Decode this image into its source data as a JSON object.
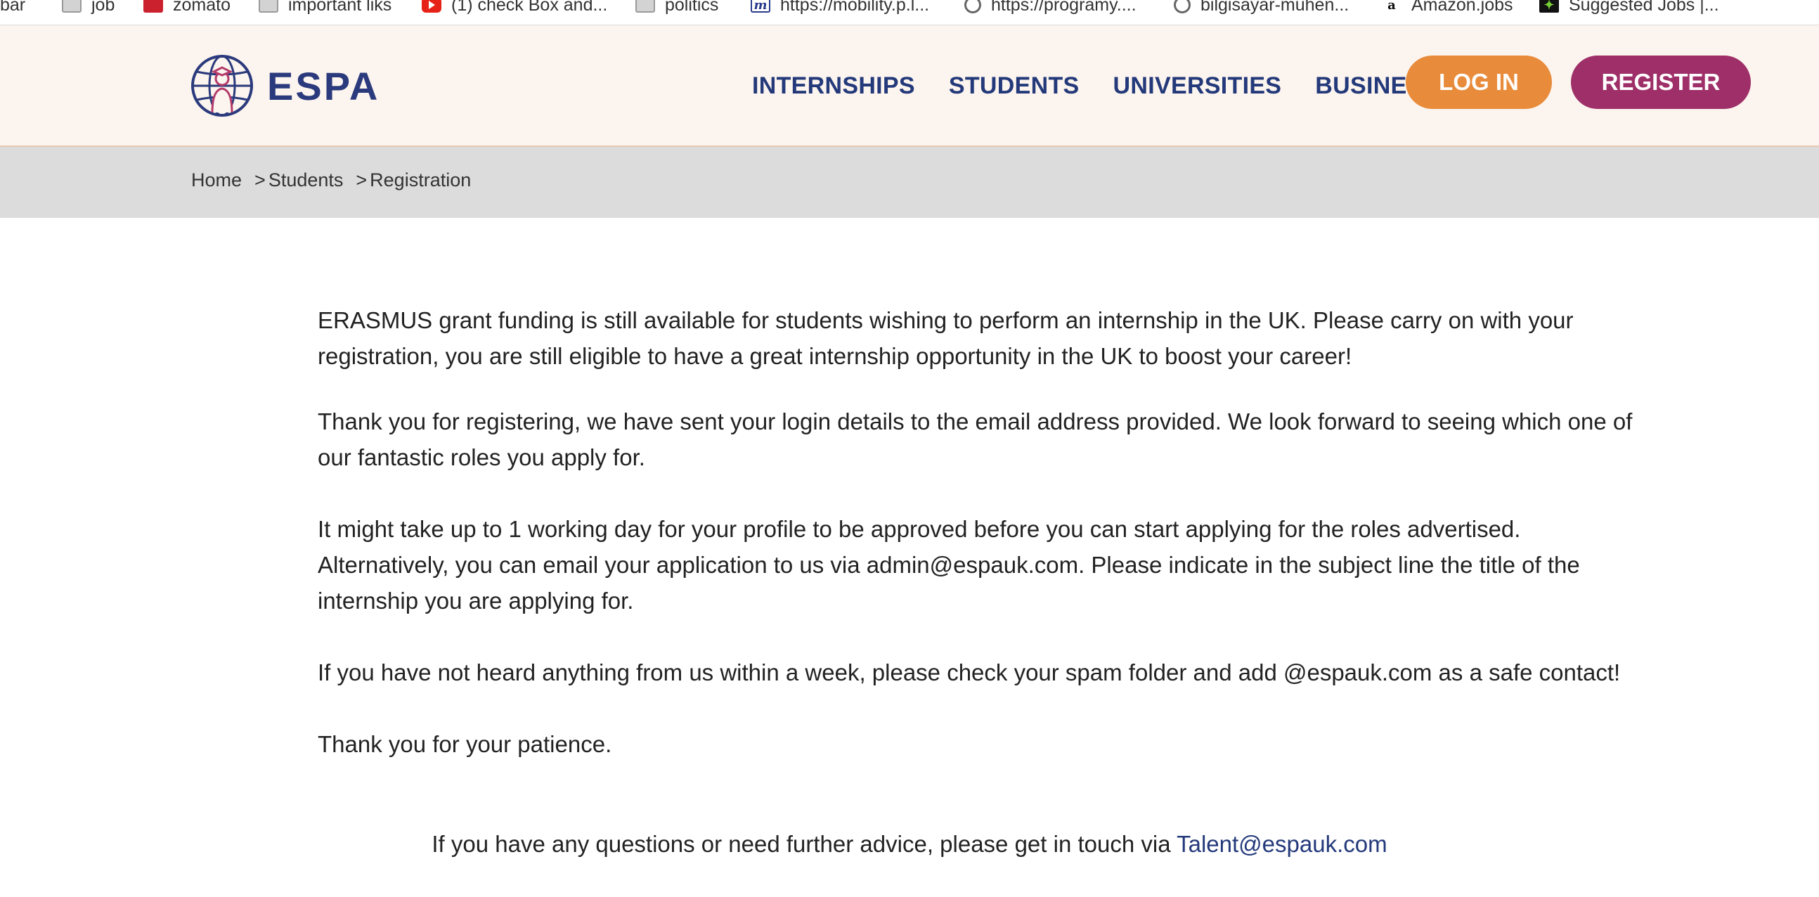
{
  "bookmarks": [
    {
      "label": "bar",
      "icon": "none"
    },
    {
      "label": "job",
      "icon": "folder-icon"
    },
    {
      "label": "zomato",
      "icon": "zomato-icon"
    },
    {
      "label": "important liks",
      "icon": "folder-icon"
    },
    {
      "label": "(1) check Box and...",
      "icon": "youtube-icon"
    },
    {
      "label": "politics",
      "icon": "folder-icon"
    },
    {
      "label": "https://mobility.p.l...",
      "icon": "mobility-icon"
    },
    {
      "label": "https://programy....",
      "icon": "globe-icon"
    },
    {
      "label": "bilgisayar-muhen...",
      "icon": "globe-icon"
    },
    {
      "label": "Amazon.jobs",
      "icon": "amazon-icon"
    },
    {
      "label": "Suggested Jobs |...",
      "icon": "jobs-icon"
    }
  ],
  "header": {
    "logo_text": "ESPA",
    "nav": [
      "INTERNSHIPS",
      "STUDENTS",
      "UNIVERSITIES",
      "BUSINESSES"
    ],
    "login_label": "LOG IN",
    "register_label": "REGISTER"
  },
  "colors": {
    "header_bg": "#fcf4ee",
    "nav_text": "#23397a",
    "login_bg": "#e88b3a",
    "register_bg": "#9e2f68",
    "breadcrumb_bg": "#dcdcdc"
  },
  "breadcrumb": {
    "home": "Home",
    "separator": ">",
    "students": "Students",
    "registration": "Registration"
  },
  "content": {
    "p1": "ERASMUS grant funding is still available for students wishing to perform an internship in the UK. Please carry on with your registration, you are still eligible to have a great internship opportunity in the UK to boost your career!",
    "p2": "Thank you for registering, we have sent your login details to the email address provided. We look forward to seeing which one of our fantastic roles you apply for.",
    "p3": "It might take up to 1 working day for your profile to be approved before you can start applying for the roles advertised. Alternatively, you can email your application to us via admin@espauk.com. Please indicate in the subject line the title of the internship you are applying for.",
    "p4": "If you have not heard anything from us within a week, please check your spam folder and add @espauk.com as a safe contact!",
    "p5": "Thank you for your patience."
  },
  "contact": {
    "text": "If you have any questions or need further advice, please get in touch via ",
    "email": "Talent@espauk.com"
  }
}
